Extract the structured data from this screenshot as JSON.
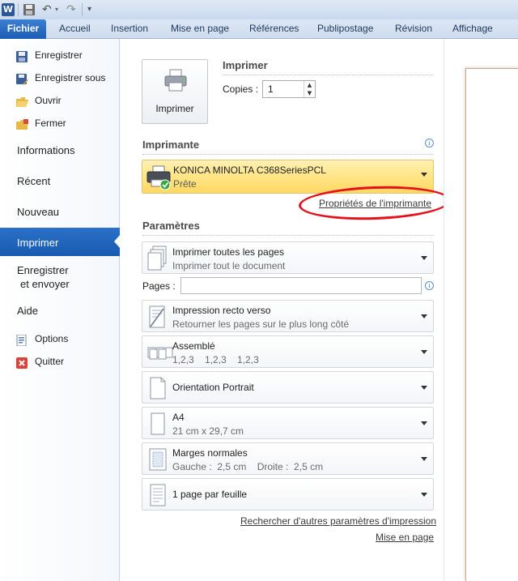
{
  "quick_access": {
    "app_icon": "W",
    "icons": [
      "word-app-icon",
      "save-icon",
      "undo-icon",
      "redo-icon",
      "customize-qat-icon"
    ]
  },
  "ribbon": {
    "tabs": [
      "Fichier",
      "Accueil",
      "Insertion",
      "Mise en page",
      "Références",
      "Publipostage",
      "Révision",
      "Affichage"
    ]
  },
  "backstage_nav": {
    "save": "Enregistrer",
    "save_as": "Enregistrer sous",
    "open": "Ouvrir",
    "close": "Fermer",
    "info": "Informations",
    "recent": "Récent",
    "new": "Nouveau",
    "print": "Imprimer",
    "send_line1": "Enregistrer",
    "send_line2": "et envoyer",
    "help": "Aide",
    "options": "Options",
    "exit": "Quitter",
    "active_item": "Imprimer",
    "active_color": "#2a6fc8"
  },
  "print_panel": {
    "print_button_label": "Imprimer",
    "heading": "Imprimer",
    "copies_label": "Copies :",
    "copies_value": "1"
  },
  "printer": {
    "heading": "Imprimante",
    "name": "KONICA MINOLTA C368SeriesPCL",
    "status": "Prête",
    "properties_link": "Propriétés de l'imprimante",
    "highlight_color": "#ffe27a",
    "annotation_color": "#e3121b"
  },
  "settings": {
    "heading": "Paramètres",
    "pages_label": "Pages :",
    "pages_value": "",
    "items": [
      {
        "title": "Imprimer toutes les pages",
        "subtitle": "Imprimer tout le document",
        "icon": "all-pages-icon"
      },
      {
        "title": "Impression recto verso",
        "subtitle": "Retourner les pages sur le plus long côté",
        "icon": "duplex-icon"
      },
      {
        "title": "Assemblé",
        "subtitle": "1,2,3    1,2,3    1,2,3",
        "icon": "collated-icon"
      },
      {
        "title": "Orientation Portrait",
        "subtitle": "",
        "icon": "portrait-icon"
      },
      {
        "title": "A4",
        "subtitle": "21 cm x 29,7 cm",
        "icon": "paper-size-icon"
      },
      {
        "title": "Marges normales",
        "subtitle": "Gauche :  2,5 cm    Droite :  2,5 cm",
        "icon": "margins-icon"
      },
      {
        "title": "1 page par feuille",
        "subtitle": "",
        "icon": "pages-per-sheet-icon"
      }
    ],
    "more_link": "Rechercher d'autres paramètres d'impression",
    "page_setup_link": "Mise en page"
  }
}
